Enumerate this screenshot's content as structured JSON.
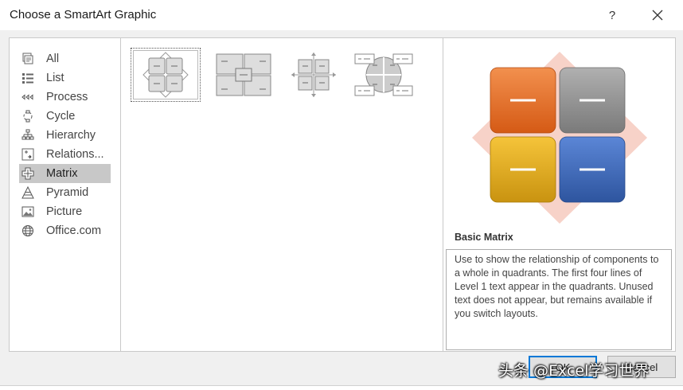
{
  "window": {
    "title": "Choose a SmartArt Graphic",
    "help_label": "?"
  },
  "categories": [
    {
      "label": "All",
      "icon": "all-icon"
    },
    {
      "label": "List",
      "icon": "list-icon"
    },
    {
      "label": "Process",
      "icon": "process-icon"
    },
    {
      "label": "Cycle",
      "icon": "cycle-icon"
    },
    {
      "label": "Hierarchy",
      "icon": "hierarchy-icon"
    },
    {
      "label": "Relations...",
      "icon": "relationship-icon"
    },
    {
      "label": "Matrix",
      "icon": "matrix-icon",
      "selected": true
    },
    {
      "label": "Pyramid",
      "icon": "pyramid-icon"
    },
    {
      "label": "Picture",
      "icon": "picture-icon"
    },
    {
      "label": "Office.com",
      "icon": "globe-icon"
    }
  ],
  "layouts": [
    {
      "icon": "basic-matrix-thumbnail-icon",
      "selected": true
    },
    {
      "icon": "titled-matrix-thumbnail-icon"
    },
    {
      "icon": "grid-matrix-thumbnail-icon"
    },
    {
      "icon": "cycle-matrix-thumbnail-icon"
    }
  ],
  "preview": {
    "title": "Basic Matrix",
    "description": "Use to show the relationship of components to a whole in quadrants. The first four lines of Level 1 text appear in the quadrants. Unused text does not appear, but remains available if you switch layouts.",
    "colors": {
      "top_left": "#e06a23",
      "top_right": "#8c8c8c",
      "bottom_left": "#e8b41a",
      "bottom_right": "#3a65b3",
      "diamond": "#f7d2c8"
    }
  },
  "buttons": {
    "ok": "OK",
    "cancel": "Cancel"
  },
  "watermark": "头条 @Excel学习世界"
}
